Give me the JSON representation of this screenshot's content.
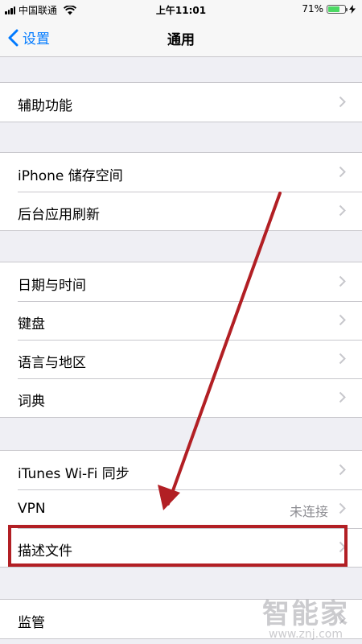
{
  "status_bar": {
    "carrier": "中国联通",
    "time": "上午11:01",
    "battery_percent": "71%",
    "battery_level": 0.71
  },
  "nav": {
    "back_label": "设置",
    "title": "通用"
  },
  "groups": [
    {
      "rows": [
        {
          "label": "辅助功能"
        }
      ]
    },
    {
      "rows": [
        {
          "label": "iPhone 储存空间"
        },
        {
          "label": "后台应用刷新"
        }
      ]
    },
    {
      "rows": [
        {
          "label": "日期与时间"
        },
        {
          "label": "键盘"
        },
        {
          "label": "语言与地区"
        },
        {
          "label": "词典"
        }
      ]
    },
    {
      "rows": [
        {
          "label": "iTunes Wi-Fi 同步"
        },
        {
          "label": "VPN",
          "value": "未连接"
        },
        {
          "label": "描述文件"
        }
      ]
    },
    {
      "rows": [
        {
          "label": "监管"
        }
      ]
    }
  ],
  "watermark": {
    "logo": "智能家",
    "url": "www.znj.com"
  },
  "colors": {
    "accent": "#007aff",
    "annotation": "#b21f24",
    "background": "#efeff4"
  }
}
